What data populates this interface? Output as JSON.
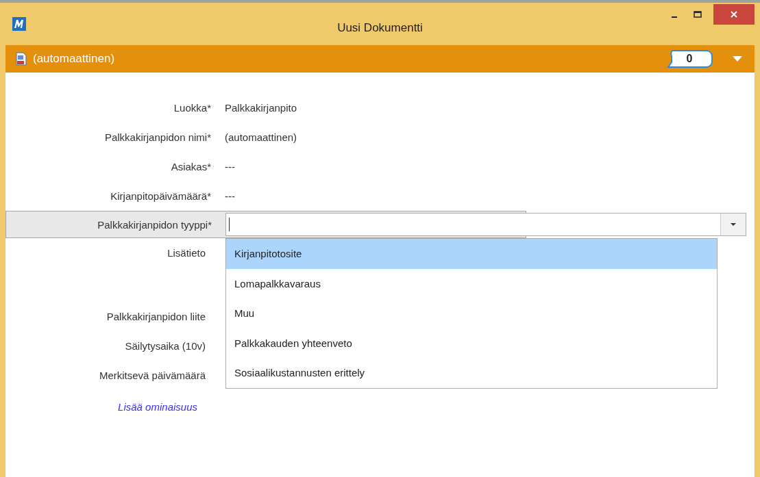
{
  "window": {
    "title": "Uusi Dokumentti"
  },
  "header": {
    "title": "(automaattinen)",
    "comment_count": "0"
  },
  "form": {
    "rows": [
      {
        "kind": "text",
        "label": "Luokka*",
        "value": "Palkkakirjanpito"
      },
      {
        "kind": "text",
        "label": "Palkkakirjanpidon nimi*",
        "value": "(automaattinen)"
      },
      {
        "kind": "text",
        "label": "Asiakas*",
        "value": "---"
      },
      {
        "kind": "text",
        "label": "Kirjanpitopäivämäärä*",
        "value": "---"
      },
      {
        "kind": "combo",
        "label": "Palkkakirjanpidon tyyppi*",
        "focused": true,
        "options": [
          {
            "label": "Kirjanpitotosite",
            "selected": true
          },
          {
            "label": "Lomapalkkavaraus",
            "selected": false
          },
          {
            "label": "Muu",
            "selected": false
          },
          {
            "label": "Palkkakauden yhteenveto",
            "selected": false
          },
          {
            "label": "Sosiaalikustannusten erittely",
            "selected": false
          }
        ]
      },
      {
        "kind": "multiline",
        "label": "Lisätieto"
      },
      {
        "kind": "empty",
        "label": "Palkkakirjanpidon liite"
      },
      {
        "kind": "empty",
        "label": "Säilytysaika (10v)"
      },
      {
        "kind": "empty",
        "label": "Merkitsevä päivämäärä"
      }
    ],
    "add_link": "Lisää ominaisuus"
  }
}
